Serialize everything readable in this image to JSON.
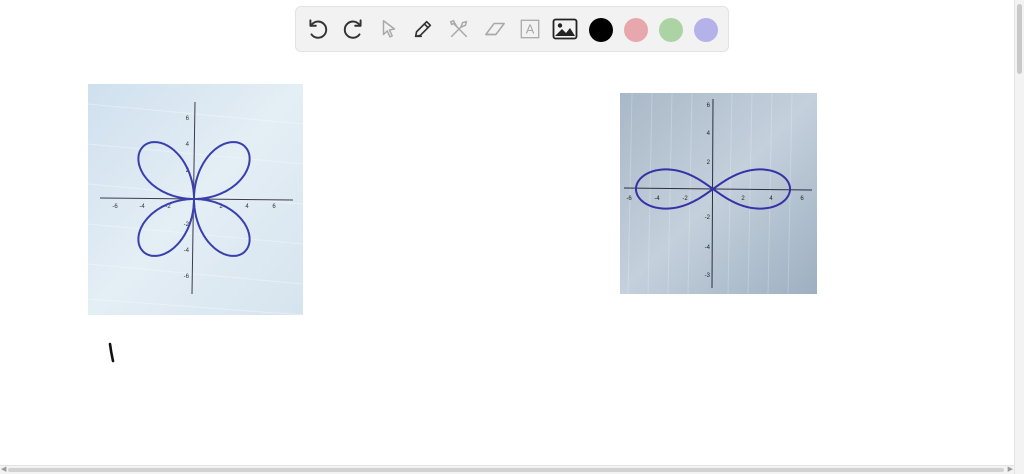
{
  "toolbar": {
    "tools": [
      {
        "name": "undo-icon"
      },
      {
        "name": "redo-icon"
      },
      {
        "name": "pointer-icon"
      },
      {
        "name": "pen-icon"
      },
      {
        "name": "tools-icon"
      },
      {
        "name": "eraser-icon"
      },
      {
        "name": "text-icon"
      },
      {
        "name": "image-icon"
      }
    ],
    "text_tool_glyph": "A",
    "colors": [
      "#000000",
      "#e8a7ad",
      "#acd3a4",
      "#b5b1e9"
    ],
    "selected_color": "#000000"
  },
  "canvas": {
    "rose_graph": {
      "curve_color": "#3a3fae",
      "x_ticks": [
        "-6",
        "-4",
        "-2",
        "2",
        "4",
        "6"
      ],
      "y_ticks": [
        "6",
        "4",
        "2",
        "-2",
        "-4",
        "-6"
      ]
    },
    "lemniscate_graph": {
      "curve_color": "#3532a8",
      "x_ticks": [
        "-6",
        "-4",
        "-2",
        "2",
        "4",
        "6"
      ],
      "y_ticks": [
        "6",
        "4",
        "2",
        "-2",
        "-4",
        "-3"
      ]
    },
    "ink_color": "#111111"
  }
}
